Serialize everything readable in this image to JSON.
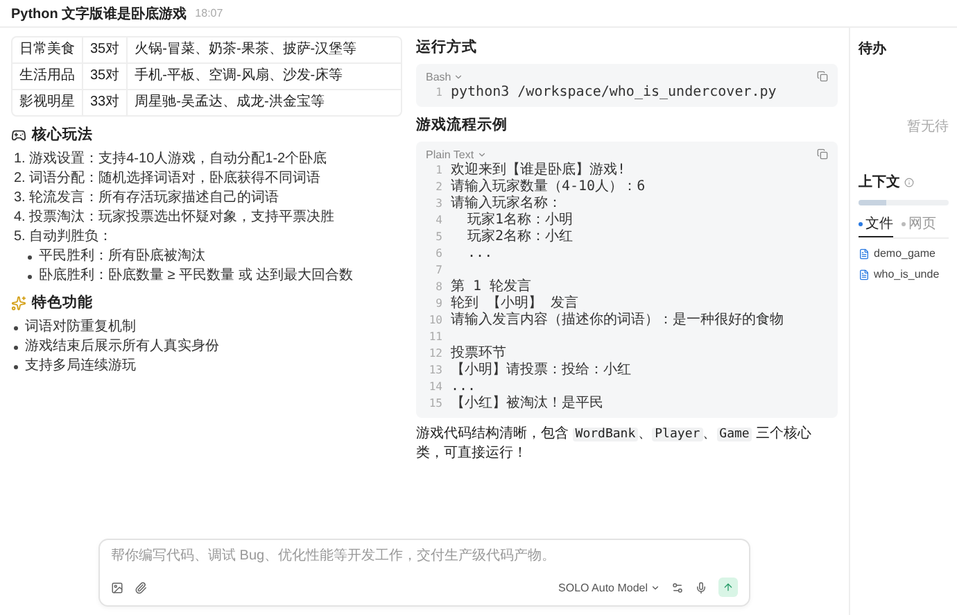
{
  "header": {
    "title": "Python 文字版谁是卧底游戏",
    "time": "18:07"
  },
  "table": {
    "rows": [
      [
        "日常美食",
        "35对",
        "火锅-冒菜、奶茶-果茶、披萨-汉堡等"
      ],
      [
        "生活用品",
        "35对",
        "手机-平板、空调-风扇、沙发-床等"
      ],
      [
        "影视明星",
        "33对",
        "周星驰-吴孟达、成龙-洪金宝等"
      ]
    ]
  },
  "sections": [
    {
      "kind": "ordered",
      "title": "核心玩法",
      "items": [
        {
          "text": "1. 游戏设置：支持4-10人游戏，自动分配1-2个卧底"
        },
        {
          "text": "2. 词语分配：随机选择词语对，卧底获得不同词语"
        },
        {
          "text": "3. 轮流发言：所有存活玩家描述自己的词语"
        },
        {
          "text": "4. 投票淘汰：玩家投票选出怀疑对象，支持平票决胜"
        },
        {
          "text": "5. 自动判胜负：",
          "children": [
            {
              "text": "平民胜利：所有卧底被淘汰"
            },
            {
              "text": "卧底胜利：卧底数量 ≥ 平民数量 或 达到最大回合数"
            }
          ]
        }
      ]
    },
    {
      "kind": "bullets",
      "title": "特色功能",
      "items": [
        {
          "text": "词语对防重复机制"
        },
        {
          "text": "游戏结束后展示所有人真实身份"
        },
        {
          "text": "支持多局连续游玩"
        }
      ]
    }
  ],
  "code_sections": [
    {
      "title": "运行方式",
      "language": "Bash",
      "lines": [
        {
          "n": "1",
          "text": "python3 /workspace/who_is_undercover.py"
        }
      ]
    },
    {
      "title": "游戏流程示例",
      "language": "Plain Text",
      "lines": [
        {
          "n": "1",
          "text": "欢迎来到【谁是卧底】游戏!"
        },
        {
          "n": "2",
          "text": "请输入玩家数量（4-10人）：6"
        },
        {
          "n": "3",
          "text": "请输入玩家名称："
        },
        {
          "n": "4",
          "text": "  玩家1名称：小明"
        },
        {
          "n": "5",
          "text": "  玩家2名称：小红"
        },
        {
          "n": "6",
          "text": "  ..."
        },
        {
          "n": "7"
        },
        {
          "n": "8",
          "text": "第 1 轮发言"
        },
        {
          "n": "9",
          "text": "轮到 【小明】 发言"
        },
        {
          "n": "10",
          "text": "请输入发言内容（描述你的词语）：是一种很好的食物"
        },
        {
          "n": "11"
        },
        {
          "n": "12",
          "text": "投票环节"
        },
        {
          "n": "13",
          "text": "【小明】请投票：投给：小红"
        },
        {
          "n": "14",
          "text": "..."
        },
        {
          "n": "15",
          "text": "【小红】被淘汰！是平民"
        }
      ]
    }
  ],
  "summary": [
    {
      "kind": "text",
      "text": "游戏代码结构清晰，包含 "
    },
    {
      "kind": "code",
      "text": "WordBank"
    },
    {
      "kind": "text",
      "text": "、"
    },
    {
      "kind": "code",
      "text": "Player"
    },
    {
      "kind": "text",
      "text": "、"
    },
    {
      "kind": "code",
      "text": "Game"
    },
    {
      "kind": "text",
      "text": " 三个核心类，可直接运行！"
    }
  ],
  "composer": {
    "placeholder": "帮你编写代码、调试 Bug、优化性能等开发工作，交付生产级代码产物。",
    "model": "SOLO Auto Model"
  },
  "sidebar": {
    "todo_title": "待办",
    "todo_empty": "暂无待",
    "context_title": "上下文",
    "context": {
      "level": 0.3
    },
    "tabs": [
      {
        "label": "文件",
        "selected": true
      },
      {
        "label": "网页",
        "selected": false
      }
    ],
    "files": [
      "demo_game",
      "who_is_unde"
    ]
  }
}
